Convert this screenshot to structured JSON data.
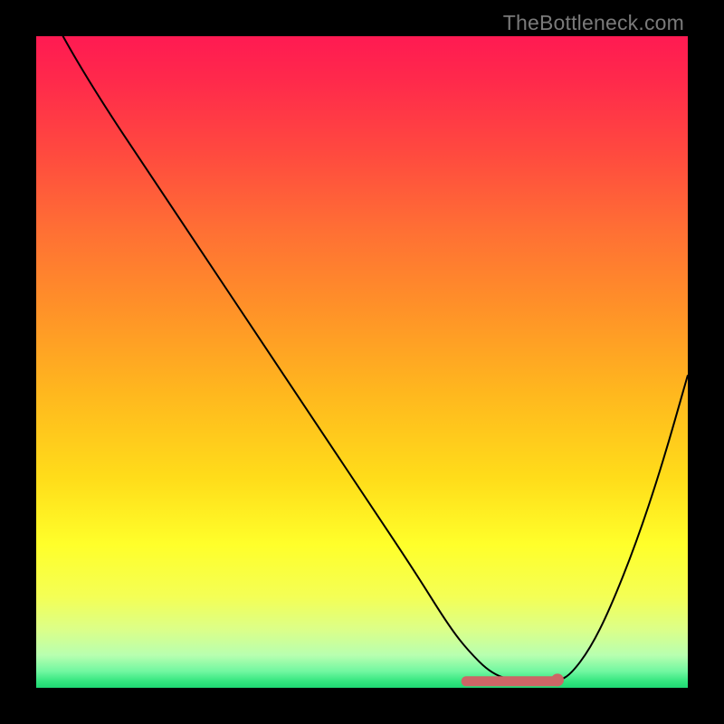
{
  "watermark": "TheBottleneck.com",
  "colors": {
    "frame": "#000000",
    "curve": "#000000",
    "marker": "#cc6666",
    "gradient_stops": [
      {
        "offset": 0.0,
        "color": "#ff1a52"
      },
      {
        "offset": 0.07,
        "color": "#ff2a4b"
      },
      {
        "offset": 0.18,
        "color": "#ff4a3f"
      },
      {
        "offset": 0.3,
        "color": "#ff7034"
      },
      {
        "offset": 0.42,
        "color": "#ff9228"
      },
      {
        "offset": 0.55,
        "color": "#ffb81e"
      },
      {
        "offset": 0.68,
        "color": "#ffdd1a"
      },
      {
        "offset": 0.78,
        "color": "#ffff2a"
      },
      {
        "offset": 0.86,
        "color": "#f4ff55"
      },
      {
        "offset": 0.91,
        "color": "#dcff88"
      },
      {
        "offset": 0.95,
        "color": "#b8ffb0"
      },
      {
        "offset": 0.975,
        "color": "#70f7a0"
      },
      {
        "offset": 0.99,
        "color": "#34e67f"
      },
      {
        "offset": 1.0,
        "color": "#1fd873"
      }
    ]
  },
  "chart_data": {
    "type": "line",
    "title": "",
    "xlabel": "",
    "ylabel": "",
    "xlim": [
      0,
      100
    ],
    "ylim": [
      0,
      100
    ],
    "series": [
      {
        "name": "bottleneck-curve",
        "x": [
          0,
          4,
          10,
          18,
          26,
          34,
          42,
          50,
          58,
          63,
          66,
          70,
          74,
          78,
          80,
          82,
          85,
          88,
          92,
          96,
          100
        ],
        "values": [
          108,
          100,
          90,
          78,
          66,
          54,
          42,
          30,
          18,
          10,
          6,
          2,
          1,
          1,
          1,
          2,
          6,
          12,
          22,
          34,
          48
        ]
      }
    ],
    "annotations": [
      {
        "type": "line-segment",
        "name": "flat-min-marker",
        "x0": 66,
        "x1": 80,
        "y": 1
      },
      {
        "type": "dot",
        "name": "min-end-dot",
        "x": 80,
        "y": 1.2
      }
    ]
  }
}
